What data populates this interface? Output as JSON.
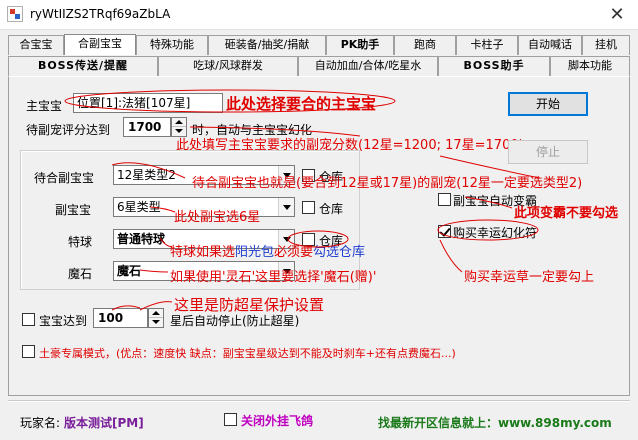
{
  "window": {
    "title": "ryWtIIZS2TRqf69aZbLA",
    "close": "✕"
  },
  "tabs_row1": [
    {
      "label": "合宝宝",
      "active": false
    },
    {
      "label": "合副宝宝",
      "active": true
    },
    {
      "label": "特殊功能",
      "active": false
    },
    {
      "label": "砸装备/抽奖/捐献",
      "active": false
    },
    {
      "label": "PK助手",
      "active": false
    },
    {
      "label": "跑商",
      "active": false
    },
    {
      "label": "卡柱子",
      "active": false
    },
    {
      "label": "自动喊话",
      "active": false
    },
    {
      "label": "挂机",
      "active": false
    }
  ],
  "tabs_row2": [
    {
      "label": "BOSS传送/提醒"
    },
    {
      "label": "吃球/风球群发"
    },
    {
      "label": "自动加血/合体/吃星水"
    },
    {
      "label": "BOSS助手"
    },
    {
      "label": "脚本功能"
    }
  ],
  "form": {
    "main_pet_label": "主宝宝",
    "main_pet_value": "位置[1]:法猪[107星]",
    "score_label": "待副宠评分达到",
    "score_value": "1700",
    "score_suffix": "时，自动与主宝宝幻化",
    "merge_pet_label": "待合副宝宝",
    "merge_pet_value": "12星类型2",
    "sub_pet_label": "副宝宝",
    "sub_pet_value": "6星类型",
    "special_ball_label": "特球",
    "special_ball_value": "普通特球",
    "magic_stone_label": "魔石",
    "magic_stone_value": "魔石",
    "warehouse_label": "仓库",
    "stop_label": "宝宝达到",
    "stop_value": "100",
    "stop_suffix": "星后自动停止(防止超星)",
    "rich_mode_label": "土豪专属模式，(优点：速度快  缺点：副宝宝星级达到不能及时刹车+还有点费魔石...)",
    "auto_change_label": "副宝宝自动变霸",
    "buy_luck_label": "购买幸运幻化符"
  },
  "buttons": {
    "start": "开始",
    "stop": "停止"
  },
  "checks": {
    "merge_pet_warehouse": false,
    "sub_pet_warehouse": false,
    "special_ball_warehouse": false,
    "stop_at_stars": false,
    "rich_mode": false,
    "auto_change": false,
    "buy_luck": true
  },
  "annotations": {
    "a1": "此处选择要合的主宝宝",
    "a2": "此处填写主宝宝要求的副宠分数(12星=1200; 17星=1700)",
    "a3": "待合副宝宝也就是(要合到12星或17星)的副宠(12星一定要选类型2)",
    "a4": "此处副宝选6星",
    "a5_part1": "特球如果选",
    "a5_part2": "阳光包",
    "a5_part3": "必须要",
    "a5_part4": "勾选仓库",
    "a6": "如果使用'灵石'这里要选择'魔石(赠)'",
    "a7": "这里是防超星保护设置",
    "a8": "此项变霸不要勾选",
    "a9": "购买幸运草一定要勾上"
  },
  "footer": {
    "player_label": "玩家名:",
    "player_value": "版本测试[PM]",
    "close_plugin": "关闭外挂飞鸽",
    "news": "找最新开区信息就上：www.898my.com"
  },
  "colors": {
    "red": "#e00000",
    "blue": "#1f3ecf",
    "purple": "#7a1f9a",
    "green": "#1a7a1a",
    "accent": "#0078d7"
  }
}
